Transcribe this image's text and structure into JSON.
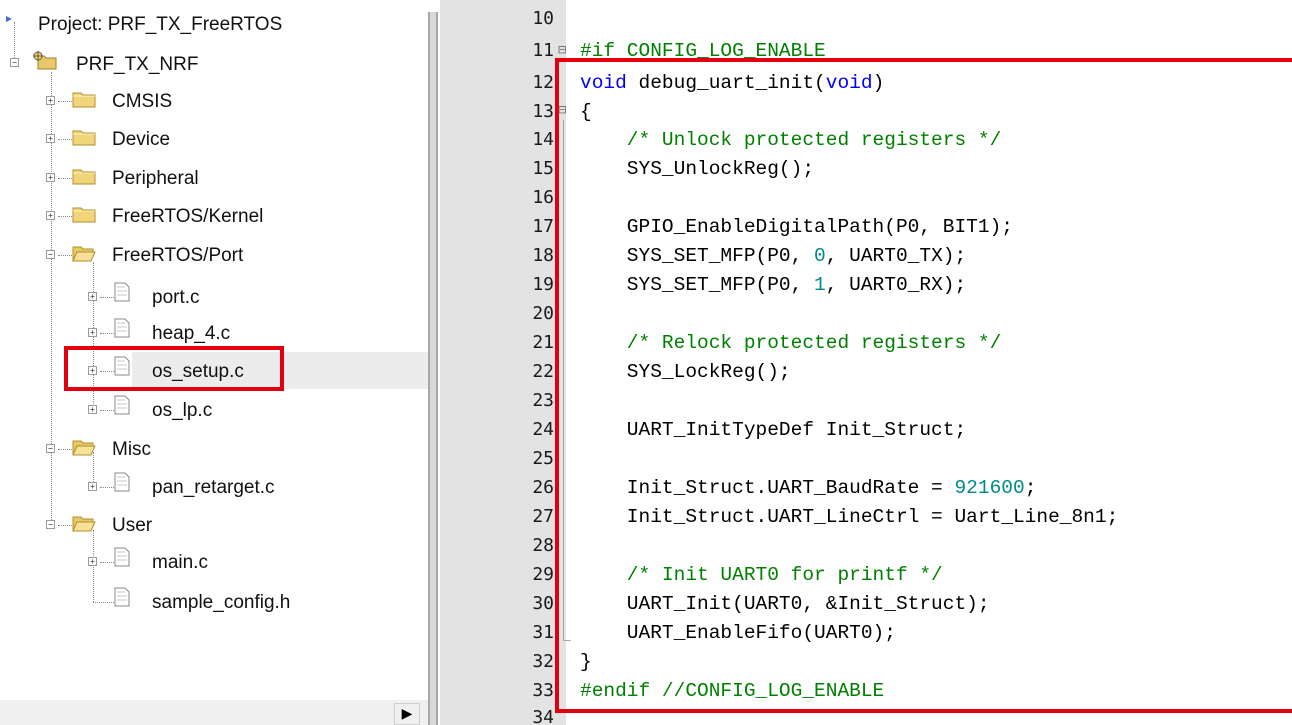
{
  "project_tree": {
    "project_label": "Project: PRF_TX_FreeRTOS",
    "target_label": "PRF_TX_NRF",
    "groups": [
      {
        "label": "CMSIS"
      },
      {
        "label": "Device"
      },
      {
        "label": "Peripheral"
      },
      {
        "label": "FreeRTOS/Kernel"
      },
      {
        "label": "FreeRTOS/Port"
      },
      {
        "label": "Misc"
      },
      {
        "label": "User"
      }
    ],
    "files": {
      "port": "port.c",
      "heap": "heap_4.c",
      "os_setup": "os_setup.c",
      "os_lp": "os_lp.c",
      "pan_retarget": "pan_retarget.c",
      "main": "main.c",
      "sample_config": "sample_config.h"
    },
    "highlighted_file": "os_setup.c"
  },
  "editor": {
    "line_numbers": [
      "10",
      "11",
      "12",
      "13",
      "14",
      "15",
      "16",
      "17",
      "18",
      "19",
      "20",
      "21",
      "22",
      "23",
      "24",
      "25",
      "26",
      "27",
      "28",
      "29",
      "30",
      "31",
      "32",
      "33",
      "34"
    ],
    "lines": {
      "l11_pp": "#if CONFIG_LOG_ENABLE",
      "l12_kw1": "void",
      "l12_mid": " debug_uart_init(",
      "l12_kw2": "void",
      "l12_end": ")",
      "l13": "{",
      "l14": "    /* Unlock protected registers */",
      "l15": "    SYS_UnlockReg();",
      "l17": "    GPIO_EnableDigitalPath(P0, BIT1);",
      "l18_a": "    SYS_SET_MFP(P0, ",
      "l18_num": "0",
      "l18_b": ", UART0_TX);",
      "l19_a": "    SYS_SET_MFP(P0, ",
      "l19_num": "1",
      "l19_b": ", UART0_RX);",
      "l21": "    /* Relock protected registers */",
      "l22": "    SYS_LockReg();",
      "l24": "    UART_InitTypeDef Init_Struct;",
      "l26_a": "    Init_Struct.UART_BaudRate = ",
      "l26_num": "921600",
      "l26_b": ";",
      "l27": "    Init_Struct.UART_LineCtrl = Uart_Line_8n1;",
      "l29": "    /* Init UART0 for printf */",
      "l30": "    UART_Init(UART0, &Init_Struct);",
      "l31": "    UART_EnableFifo(UART0);",
      "l32": "}",
      "l33": "#endif //CONFIG_LOG_ENABLE"
    }
  },
  "colors": {
    "highlight_border": "#e1000f",
    "keyword": "#0000ff",
    "comment": "#008000",
    "number": "#008b8b",
    "gutter": "#e3e3e3"
  },
  "icons": {
    "folder": "folder-icon",
    "file": "file-icon",
    "expand": "plus-expander-icon",
    "collapse": "minus-expander-icon"
  }
}
